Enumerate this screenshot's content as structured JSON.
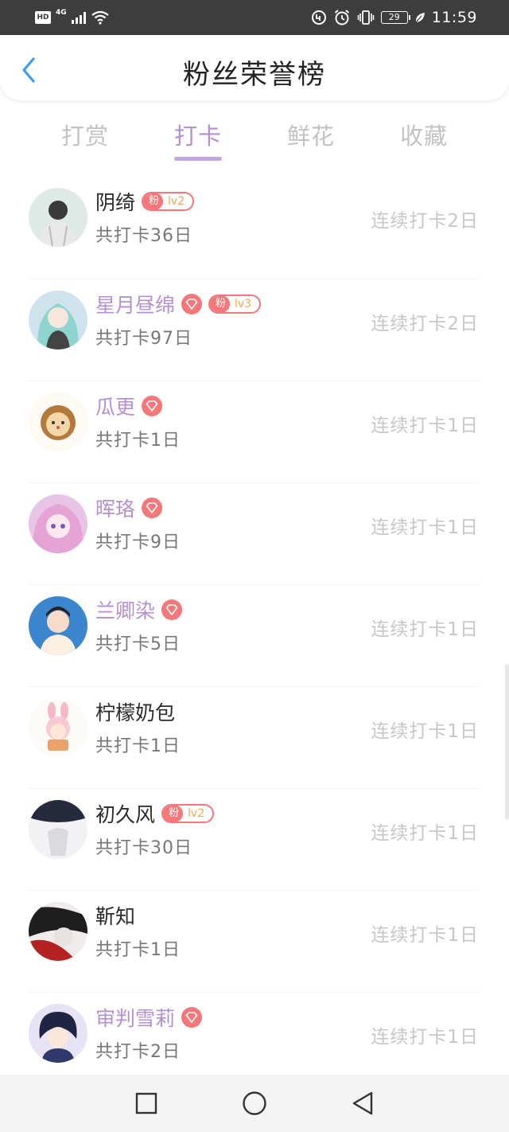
{
  "status_bar": {
    "hd_label": "HD",
    "network_label": "4G",
    "battery_level": "29",
    "time": "11:59"
  },
  "header": {
    "title": "粉丝荣誉榜"
  },
  "tabs": [
    {
      "label": "打赏",
      "active": false
    },
    {
      "label": "打卡",
      "active": true
    },
    {
      "label": "鲜花",
      "active": false
    },
    {
      "label": "收藏",
      "active": false
    }
  ],
  "fans": [
    {
      "name": "阴绮",
      "vip": false,
      "diamond": false,
      "fan_badge": {
        "label": "粉",
        "level": "lv2"
      },
      "total": "共打卡36日",
      "streak": "连续打卡2日"
    },
    {
      "name": "星月昼绵",
      "vip": true,
      "diamond": true,
      "fan_badge": {
        "label": "粉",
        "level": "lv3"
      },
      "total": "共打卡97日",
      "streak": "连续打卡2日"
    },
    {
      "name": "瓜更",
      "vip": true,
      "diamond": true,
      "fan_badge": null,
      "total": "共打卡1日",
      "streak": "连续打卡1日"
    },
    {
      "name": "晖珞",
      "vip": true,
      "diamond": true,
      "fan_badge": null,
      "total": "共打卡9日",
      "streak": "连续打卡1日"
    },
    {
      "name": "兰卿染",
      "vip": true,
      "diamond": true,
      "fan_badge": null,
      "total": "共打卡5日",
      "streak": "连续打卡1日"
    },
    {
      "name": "柠檬奶包",
      "vip": false,
      "diamond": false,
      "fan_badge": null,
      "total": "共打卡1日",
      "streak": "连续打卡1日"
    },
    {
      "name": "初久风",
      "vip": false,
      "diamond": false,
      "fan_badge": {
        "label": "粉",
        "level": "lv2"
      },
      "total": "共打卡30日",
      "streak": "连续打卡1日"
    },
    {
      "name": "靳知",
      "vip": false,
      "diamond": false,
      "fan_badge": null,
      "total": "共打卡1日",
      "streak": "连续打卡1日"
    },
    {
      "name": "审判雪莉",
      "vip": true,
      "diamond": true,
      "fan_badge": null,
      "total": "共打卡2日",
      "streak": "连续打卡1日"
    }
  ],
  "colors": {
    "accent": "#b490d2",
    "badge": "#f4777a",
    "badge_level": "#f0a94a",
    "back_arrow": "#3d9be9"
  }
}
